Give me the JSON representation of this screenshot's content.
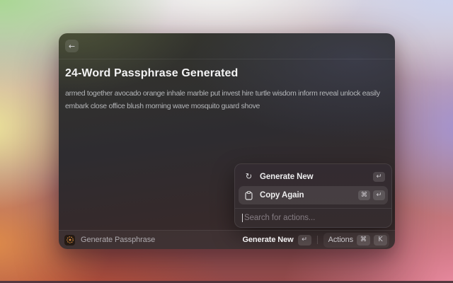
{
  "window": {
    "title": "24-Word Passphrase Generated",
    "passphrase": "armed together avocado orange inhale marble put invest hire turtle wisdom inform reveal unlock easily embark close office blush morning wave mosquito guard shove"
  },
  "icons": {
    "back": "←",
    "refresh": "↻"
  },
  "actions_menu": {
    "items": [
      {
        "label": "Generate New",
        "icon": "refresh-icon",
        "shortcuts": [
          "↵"
        ],
        "highlighted": false
      },
      {
        "label": "Copy Again",
        "icon": "clipboard-icon",
        "shortcuts": [
          "⌘",
          "↵"
        ],
        "highlighted": true
      }
    ],
    "search_placeholder": "Search for actions..."
  },
  "status_bar": {
    "app_name": "Generate Passphrase",
    "primary_action": {
      "label": "Generate New",
      "shortcut": "↵"
    },
    "actions_button": {
      "label": "Actions",
      "shortcuts": [
        "⌘",
        "K"
      ]
    }
  },
  "colors": {
    "extension_icon_accent": "#d3893c",
    "popup_highlight": "rgba(255,255,255,0.09)",
    "window_base": "#2e2c30"
  }
}
